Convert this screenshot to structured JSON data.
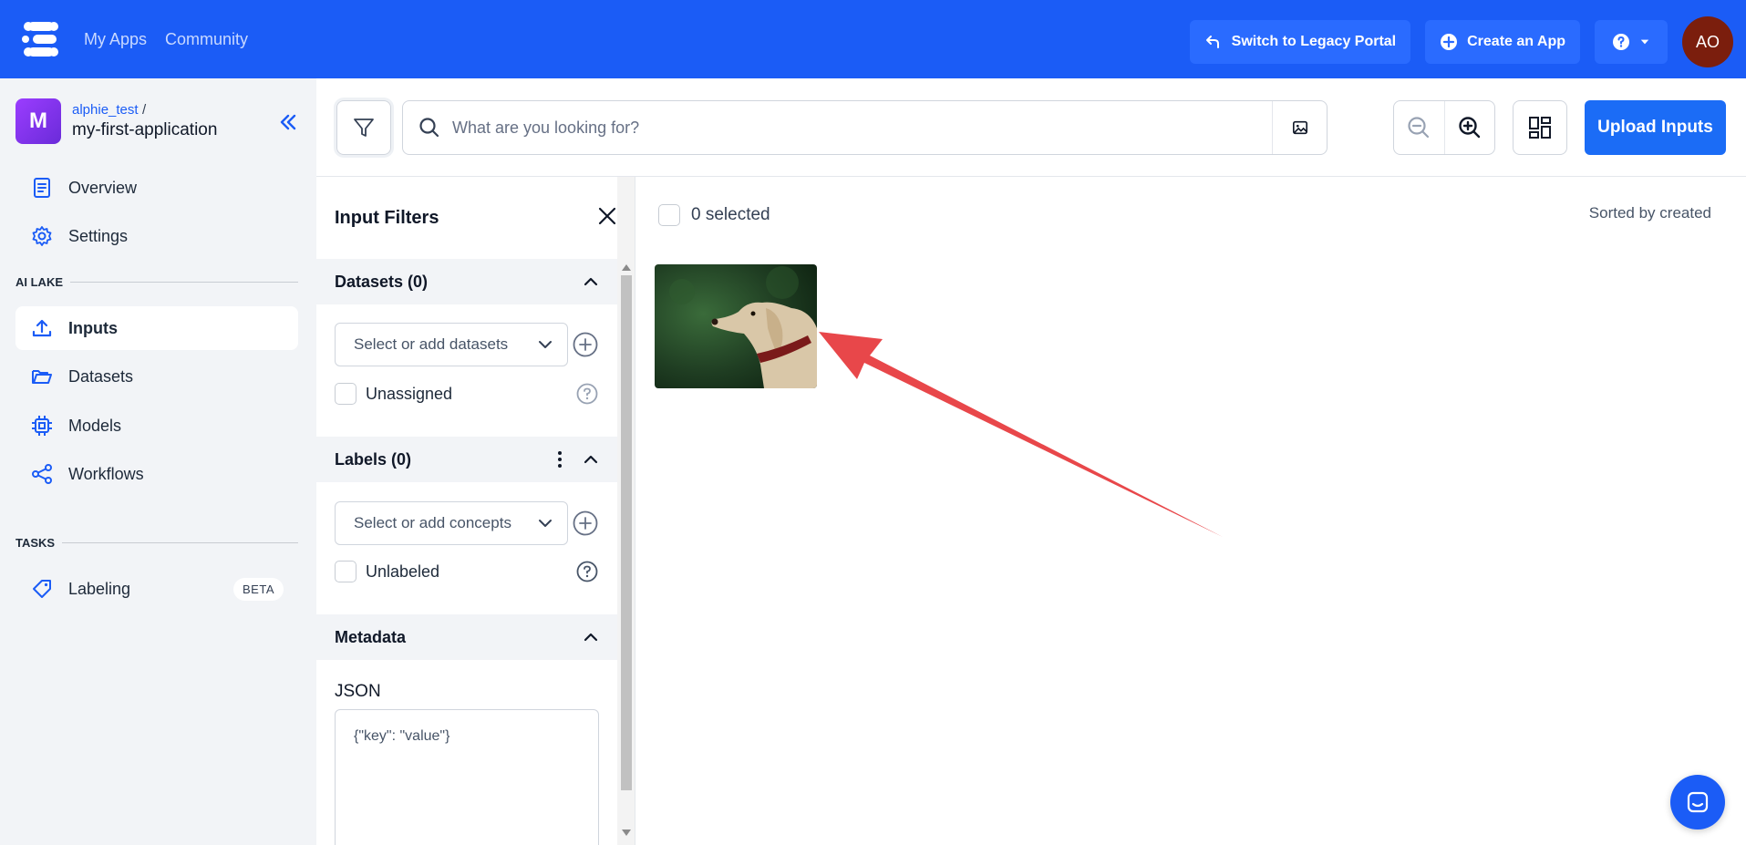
{
  "topbar": {
    "nav": [
      "My Apps",
      "Community"
    ],
    "legacy_label": "Switch to Legacy Portal",
    "create_label": "Create an App",
    "user_initials": "AO"
  },
  "sidebar": {
    "app_avatar": "M",
    "app_user": "alphie_test",
    "app_slash": "/",
    "app_name": "my-first-application",
    "items_top": [
      {
        "label": "Overview",
        "icon": "document-icon"
      },
      {
        "label": "Settings",
        "icon": "gear-icon"
      }
    ],
    "section_ai_lake": "AI LAKE",
    "items_ai_lake": [
      {
        "label": "Inputs",
        "icon": "upload-icon",
        "active": true
      },
      {
        "label": "Datasets",
        "icon": "folder-icon"
      },
      {
        "label": "Models",
        "icon": "chip-icon"
      },
      {
        "label": "Workflows",
        "icon": "share-icon"
      }
    ],
    "section_tasks": "TASKS",
    "items_tasks": [
      {
        "label": "Labeling",
        "icon": "tag-icon",
        "badge": "BETA"
      }
    ]
  },
  "search": {
    "placeholder": "What are you looking for?",
    "upload_label": "Upload Inputs"
  },
  "filters": {
    "title": "Input Filters",
    "datasets_header": "Datasets (0)",
    "datasets_placeholder": "Select or add datasets",
    "unassigned_label": "Unassigned",
    "labels_header": "Labels (0)",
    "concepts_placeholder": "Select or add concepts",
    "unlabeled_label": "Unlabeled",
    "metadata_header": "Metadata",
    "json_label": "JSON",
    "json_placeholder": "{\"key\": \"value\"}"
  },
  "main": {
    "selected_text": "0 selected",
    "sorted_text": "Sorted by created"
  },
  "colors": {
    "brand": "#1b5cf6",
    "arrow": "#e8474a"
  }
}
